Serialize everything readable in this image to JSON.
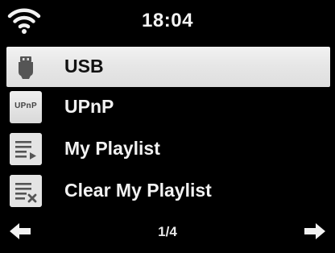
{
  "status_bar": {
    "time": "18:04",
    "wifi_icon": "wifi-icon"
  },
  "menu": {
    "selected_index": 0,
    "items": [
      {
        "label": "USB",
        "icon": "usb-icon",
        "selected": true
      },
      {
        "label": "UPnP",
        "icon": "upnp-icon",
        "icon_text": "UPnP",
        "selected": false
      },
      {
        "label": "My Playlist",
        "icon": "playlist-icon",
        "selected": false
      },
      {
        "label": "Clear My Playlist",
        "icon": "clear-playlist-icon",
        "selected": false
      }
    ]
  },
  "footer": {
    "page_indicator": "1/4",
    "left_icon": "left-arrow-icon",
    "right_icon": "right-arrow-icon"
  },
  "colors": {
    "background": "#000000",
    "text": "#f2f2f2",
    "selection": "#e8e8e8",
    "selected_text": "#111111"
  }
}
